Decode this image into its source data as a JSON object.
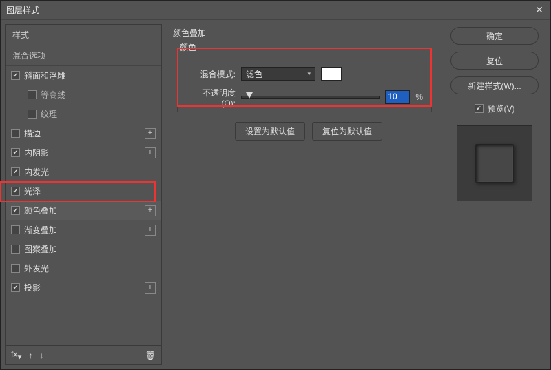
{
  "dialog_title": "图层样式",
  "close_glyph": "✕",
  "left": {
    "header": "样式",
    "blend_options": "混合选项",
    "items": [
      {
        "label": "斜面和浮雕",
        "checked": true,
        "add": false,
        "indent": 0
      },
      {
        "label": "等高线",
        "checked": false,
        "add": false,
        "indent": 1
      },
      {
        "label": "纹理",
        "checked": false,
        "add": false,
        "indent": 1
      },
      {
        "label": "描边",
        "checked": false,
        "add": true,
        "indent": 0
      },
      {
        "label": "内阴影",
        "checked": true,
        "add": true,
        "indent": 0
      },
      {
        "label": "内发光",
        "checked": true,
        "add": false,
        "indent": 0
      },
      {
        "label": "光泽",
        "checked": true,
        "add": false,
        "indent": 0
      },
      {
        "label": "颜色叠加",
        "checked": true,
        "add": true,
        "indent": 0,
        "selected": true
      },
      {
        "label": "渐变叠加",
        "checked": false,
        "add": true,
        "indent": 0
      },
      {
        "label": "图案叠加",
        "checked": false,
        "add": false,
        "indent": 0
      },
      {
        "label": "外发光",
        "checked": false,
        "add": false,
        "indent": 0
      },
      {
        "label": "投影",
        "checked": true,
        "add": true,
        "indent": 0
      }
    ],
    "footer_fx": "fx",
    "footer_plus": "+"
  },
  "middle": {
    "panel_title": "颜色叠加",
    "group_label": "颜色",
    "blend_mode_label": "混合模式:",
    "blend_mode_value": "滤色",
    "opacity_label": "不透明度(O):",
    "opacity_value": "10",
    "percent": "%",
    "swatch_color": "#ffffff",
    "set_default": "设置为默认值",
    "reset_default": "复位为默认值"
  },
  "right": {
    "ok": "确定",
    "reset": "复位",
    "new_style": "新建样式(W)...",
    "preview_label": "预览(V)",
    "preview_checked": true
  }
}
